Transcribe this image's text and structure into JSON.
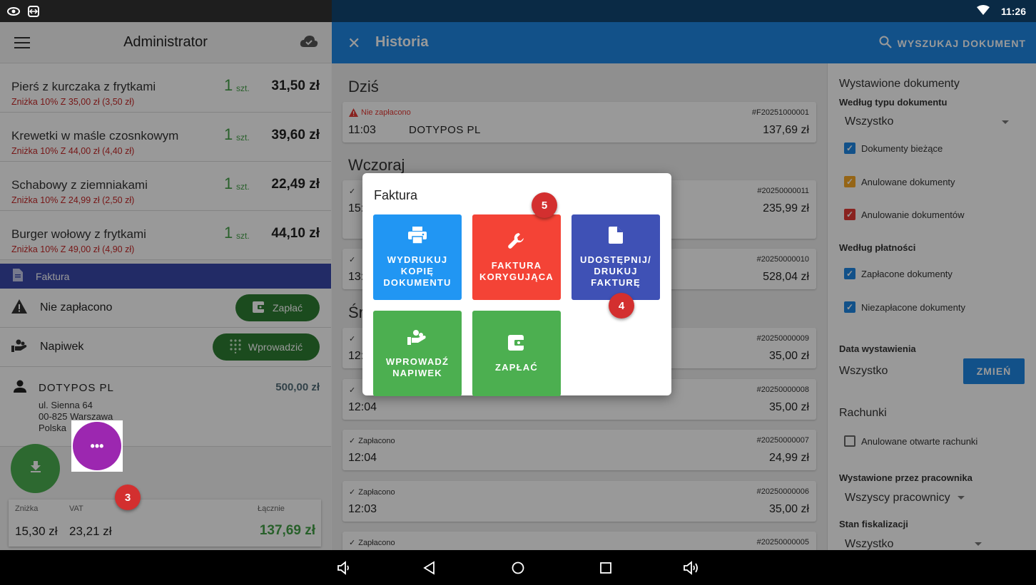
{
  "status_bar": {
    "time": "11:26"
  },
  "left": {
    "title": "Administrator",
    "items": [
      {
        "name": "Pierś z kurczaka z frytkami",
        "discount": "Zniżka 10% Z 35,00 zł (3,50 zł)",
        "qty": "1",
        "unit": "szt.",
        "price": "31,50 zł"
      },
      {
        "name": "Krewetki w maśle czosnkowym",
        "discount": "Zniżka 10% Z 44,00 zł (4,40 zł)",
        "qty": "1",
        "unit": "szt.",
        "price": "39,60 zł"
      },
      {
        "name": "Schabowy z ziemniakami",
        "discount": "Zniżka 10% Z 24,99 zł (2,50 zł)",
        "qty": "1",
        "unit": "szt.",
        "price": "22,49 zł"
      },
      {
        "name": "Burger wołowy z frytkami",
        "discount": "Zniżka 10% Z 49,00 zł (4,90 zł)",
        "qty": "1",
        "unit": "szt.",
        "price": "44,10 zł"
      }
    ],
    "faktura_label": "Faktura",
    "unpaid_label": "Nie zapłacono",
    "pay_button": "Zapłać",
    "tip_label": "Napiwek",
    "enter_button": "Wprowadzić",
    "customer": {
      "name": "DOTYPOS PL",
      "credit": "500,00 zł",
      "street": "ul. Sienna 64",
      "city": "00-825 Warszawa",
      "country": "Polska"
    },
    "fab_more": "•••",
    "totals": {
      "discount_label": "Zniżka",
      "vat_label": "VAT",
      "total_label": "Łącznie",
      "discount": "15,30 zł",
      "vat": "23,21 zł",
      "total": "137,69 zł"
    }
  },
  "right": {
    "title": "Historia",
    "search_label": "WYSZUKAJ DOKUMENT",
    "sections": {
      "today": "Dziś",
      "yesterday": "Wczoraj",
      "wednesday": "Śr"
    },
    "docs": [
      {
        "status": "Nie zapłacono",
        "number": "#F20251000001",
        "time": "11:03",
        "customer": "DOTYPOS PL",
        "amount": "137,69 zł"
      },
      {
        "status": "",
        "number": "#20250000011",
        "time": "15:",
        "customer": "",
        "amount": "235,99 zł"
      },
      {
        "status": "",
        "number": "#20250000010",
        "time": "13:",
        "customer": "",
        "amount": "528,04 zł"
      },
      {
        "status": "",
        "number": "#20250000009",
        "time": "12:",
        "customer": "",
        "amount": "35,00 zł"
      },
      {
        "status": "",
        "number": "#20250000008",
        "time": "12:04",
        "customer": "",
        "amount": "35,00 zł"
      },
      {
        "status": "Zapłacono",
        "number": "#20250000007",
        "time": "12:04",
        "customer": "",
        "amount": "24,99 zł"
      },
      {
        "status": "Zapłacono",
        "number": "#20250000006",
        "time": "12:03",
        "customer": "",
        "amount": "35,00 zł"
      },
      {
        "status": "Zapłacono",
        "number": "#20250000005",
        "time": "",
        "customer": "",
        "amount": ""
      }
    ],
    "filters": {
      "issued_docs": "Wystawione dokumenty",
      "by_type": "Według typu dokumentu",
      "type_value": "Wszystko",
      "cb_current": "Dokumenty bieżące",
      "cb_cancelled": "Anulowane dokumenty",
      "cb_cancellation": "Anulowanie dokumentów",
      "by_payment": "Według płatności",
      "cb_paid": "Zapłacone dokumenty",
      "cb_unpaid": "Niezapłacone dokumenty",
      "issue_date": "Data wystawienia",
      "date_value": "Wszystko",
      "change_button": "ZMIEŃ",
      "bills": "Rachunki",
      "cb_open_cancelled": "Anulowane otwarte rachunki",
      "by_employee": "Wystawione przez pracownika",
      "employee_value": "Wszyscy pracownicy",
      "fiscal_state": "Stan fiskalizacji",
      "fiscal_value": "Wszystko",
      "colors": {
        "blue": "#1e88e5",
        "amber": "#f9a825",
        "red": "#e53935"
      }
    }
  },
  "dialog": {
    "title": "Faktura",
    "tiles": {
      "print_copy": "WYDRUKUJ KOPIĘ DOKUMENTU",
      "correction": "FAKTURA KORYGUJĄCA",
      "share": "UDOSTĘPNIJ/ DRUKUJ FAKTURĘ",
      "tip": "WPROWADŹ NAPIWEK",
      "pay": "ZAPŁAĆ"
    }
  },
  "badges": {
    "b3": "3",
    "b4": "4",
    "b5": "5"
  }
}
